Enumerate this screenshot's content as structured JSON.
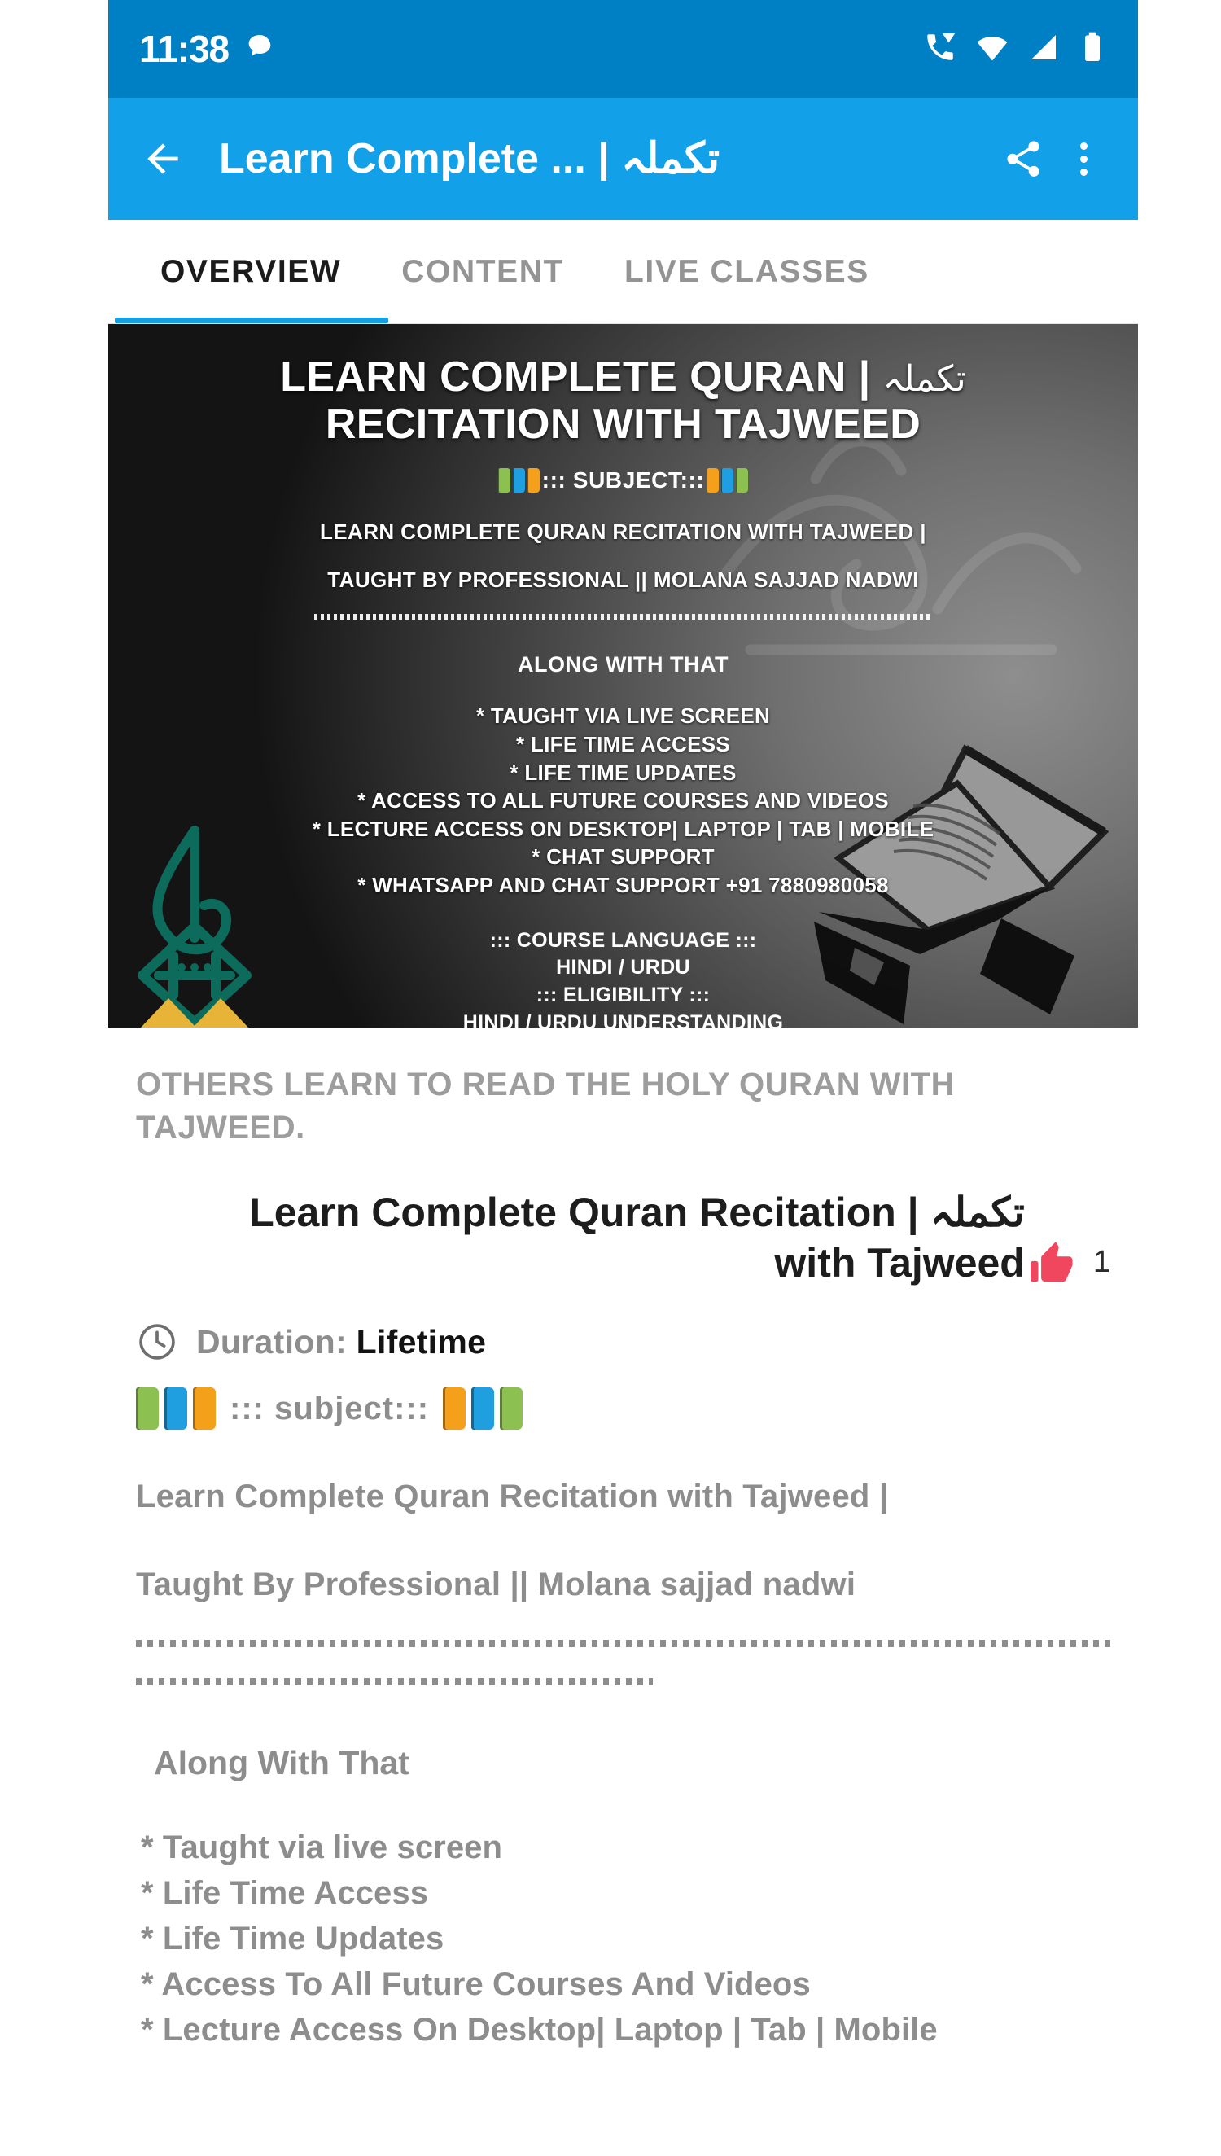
{
  "status_bar": {
    "time": "11:38",
    "icons": [
      "chat-bubble-icon",
      "volte-call-icon",
      "wifi-icon",
      "signal-icon",
      "battery-icon"
    ],
    "background": "#0080c4"
  },
  "app_bar": {
    "back_label": "←",
    "title": "Learn Complete ... | تكملہ",
    "share_icon": "share-icon",
    "overflow_icon": "more-vertical-icon",
    "background": "#12a0e8"
  },
  "tabs": {
    "items": [
      {
        "label": "OVERVIEW",
        "active": true
      },
      {
        "label": "CONTENT",
        "active": false
      },
      {
        "label": "LIVE CLASSES",
        "active": false
      }
    ],
    "indicator_color": "#169ee0",
    "active_color": "#1b1b1b",
    "inactive_color": "#949494"
  },
  "banner": {
    "heading_line1": "LEARN COMPLETE QURAN |",
    "heading_arabic": "تكملہ",
    "heading_line2": "RECITATION WITH TAJWEED",
    "subject_label": "::: SUBJECT:::",
    "line1": "LEARN COMPLETE QURAN RECITATION WITH TAJWEED |",
    "line2": "TAUGHT BY PROFESSIONAL || MOLANA SAJJAD NADWI",
    "along_with_that": "ALONG WITH THAT",
    "features": [
      "* TAUGHT VIA LIVE SCREEN",
      "* LIFE TIME ACCESS",
      "* LIFE TIME UPDATES",
      "* ACCESS TO ALL FUTURE COURSES AND VIDEOS",
      "* LECTURE ACCESS ON DESKTOP| LAPTOP | TAB | MOBILE",
      "* CHAT SUPPORT",
      "* WHATSAPP AND CHAT  SUPPORT +91 7880980058"
    ],
    "meta": [
      "::: COURSE LANGUAGE :::",
      "HINDI / URDU",
      "::: ELIGIBILITY :::",
      "HINDI / URDU UNDERSTANDING"
    ],
    "logo_icon": "arabic-calligraphy-logo",
    "book_icon": "open-quran-on-rehal-icon"
  },
  "overview": {
    "subtitle": "OTHERS LEARN TO READ THE HOLY QURAN WITH TAJWEED.",
    "course_title_line1": "Learn Complete Quran Recitation | تكملہ",
    "course_title_line2": "with Tajweed",
    "like_icon": "thumbs-up-icon",
    "like_color": "#f0475f",
    "like_count": "1",
    "duration_icon": "clock-icon",
    "duration_label": "Duration:",
    "duration_value": "Lifetime",
    "subject_label": "::: subject:::",
    "book_colors_left": [
      "#8cc152",
      "#1f9ee0",
      "#f5a01b"
    ],
    "book_colors_right": [
      "#f5a01b",
      "#1f9ee0",
      "#8cc152"
    ],
    "paragraph1": "Learn Complete Quran Recitation with Tajweed |",
    "paragraph2": "Taught By Professional || Molana sajjad nadwi",
    "along_with_that": "Along With That",
    "bullets": [
      "* Taught via live screen",
      "* Life Time Access",
      "* Life Time Updates",
      "* Access To All Future Courses And Videos",
      "* Lecture Access On Desktop| Laptop | Tab | Mobile"
    ],
    "muted_color": "#8d8d8d"
  }
}
